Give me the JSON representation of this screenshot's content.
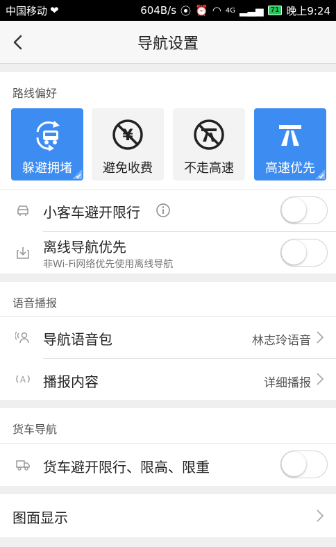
{
  "status_bar": {
    "carrier": "中国移动",
    "speed": "604B/s",
    "network": "4G",
    "battery": "71",
    "time": "晚上9:24"
  },
  "header": {
    "title": "导航设置"
  },
  "route_pref": {
    "title": "路线偏好",
    "options": [
      {
        "label": "躲避拥堵",
        "icon": "avoid-congestion-icon",
        "selected": true
      },
      {
        "label": "避免收费",
        "icon": "no-toll-icon",
        "selected": false
      },
      {
        "label": "不走高速",
        "icon": "no-highway-icon",
        "selected": false
      },
      {
        "label": "高速优先",
        "icon": "highway-icon",
        "selected": true
      }
    ],
    "car_restriction": {
      "label": "小客车避开限行",
      "icon": "car-icon",
      "enabled": false
    },
    "offline_nav": {
      "label": "离线导航优先",
      "sublabel": "非Wi-Fi网络优先使用离线导航",
      "icon": "download-icon",
      "enabled": false
    }
  },
  "voice": {
    "title": "语音播报",
    "voice_pack": {
      "label": "导航语音包",
      "value": "林志玲语音",
      "icon": "voice-person-icon"
    },
    "broadcast": {
      "label": "播报内容",
      "value": "详细播报",
      "icon": "broadcast-icon"
    }
  },
  "truck": {
    "title": "货车导航",
    "avoid": {
      "label": "货车避开限行、限高、限重",
      "icon": "truck-icon",
      "enabled": false
    }
  },
  "display": {
    "label": "图面显示"
  },
  "colors": {
    "accent": "#3d8cf1",
    "tile_bg": "#f3f3f3",
    "page_bg": "#efefef"
  }
}
